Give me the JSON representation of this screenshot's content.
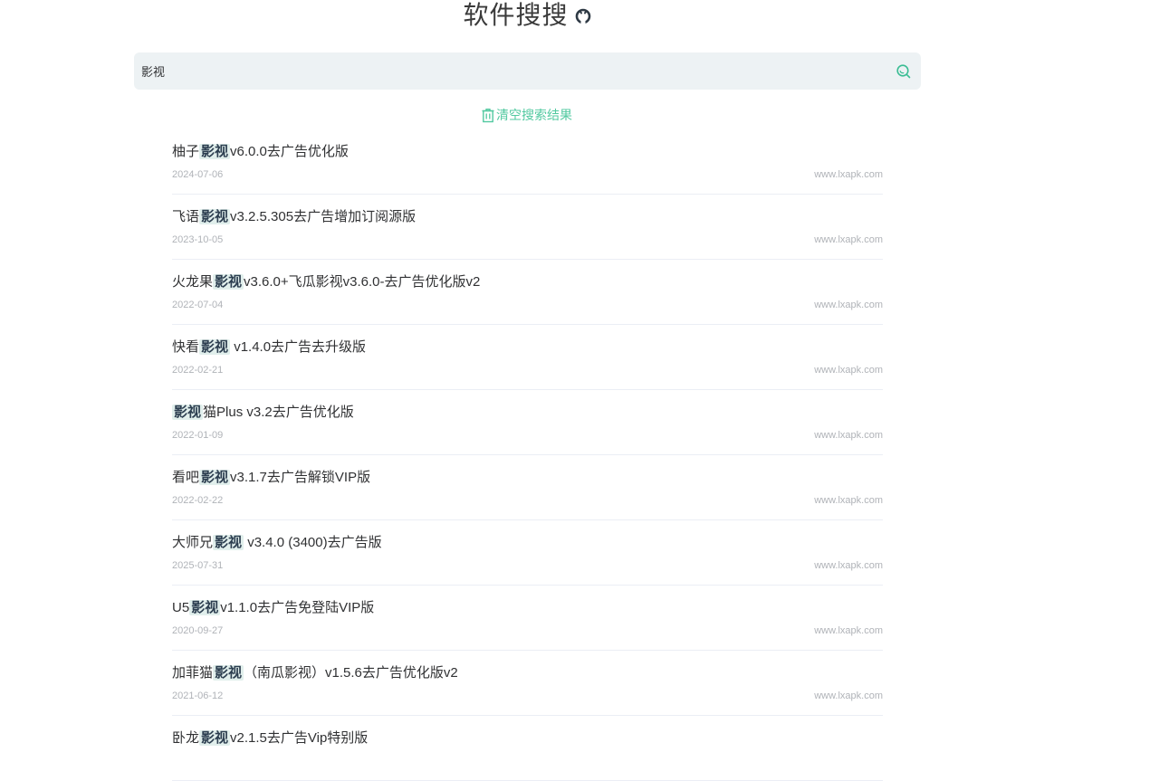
{
  "header": {
    "title": "软件搜搜"
  },
  "search": {
    "value": "影视",
    "placeholder": ""
  },
  "clear_label": "清空搜索结果",
  "colors": {
    "accent": "#52c9a0",
    "highlight_bg": "#e1efec",
    "search_bg": "#edf2f4"
  },
  "icons": {
    "github": "github-icon",
    "search": "search-icon",
    "trash": "trash-icon"
  },
  "results": [
    {
      "prefix": "柚子",
      "keyword": "影视",
      "suffix": "v6.0.0去广告优化版",
      "date": "2024-07-06",
      "source": "www.lxapk.com"
    },
    {
      "prefix": "飞语",
      "keyword": "影视",
      "suffix": "v3.2.5.305去广告增加订阅源版",
      "date": "2023-10-05",
      "source": "www.lxapk.com"
    },
    {
      "prefix": "火龙果",
      "keyword": "影视",
      "suffix": "v3.6.0+飞瓜影视v3.6.0-去广告优化版v2",
      "date": "2022-07-04",
      "source": "www.lxapk.com"
    },
    {
      "prefix": "快看",
      "keyword": "影视",
      "suffix": " v1.4.0去广告去升级版",
      "date": "2022-02-21",
      "source": "www.lxapk.com"
    },
    {
      "prefix": "",
      "keyword": "影视",
      "suffix": "猫Plus v3.2去广告优化版",
      "date": "2022-01-09",
      "source": "www.lxapk.com"
    },
    {
      "prefix": "看吧",
      "keyword": "影视",
      "suffix": "v3.1.7去广告解锁VIP版",
      "date": "2022-02-22",
      "source": "www.lxapk.com"
    },
    {
      "prefix": "大师兄",
      "keyword": "影视",
      "suffix": " v3.4.0 (3400)去广告版",
      "date": "2025-07-31",
      "source": "www.lxapk.com"
    },
    {
      "prefix": "U5",
      "keyword": "影视",
      "suffix": "v1.1.0去广告免登陆VIP版",
      "date": "2020-09-27",
      "source": "www.lxapk.com"
    },
    {
      "prefix": "加菲猫",
      "keyword": "影视",
      "suffix": "（南瓜影视）v1.5.6去广告优化版v2",
      "date": "2021-06-12",
      "source": "www.lxapk.com"
    },
    {
      "prefix": "卧龙",
      "keyword": "影视",
      "suffix": "v2.1.5去广告Vip特别版",
      "date": "",
      "source": ""
    }
  ]
}
